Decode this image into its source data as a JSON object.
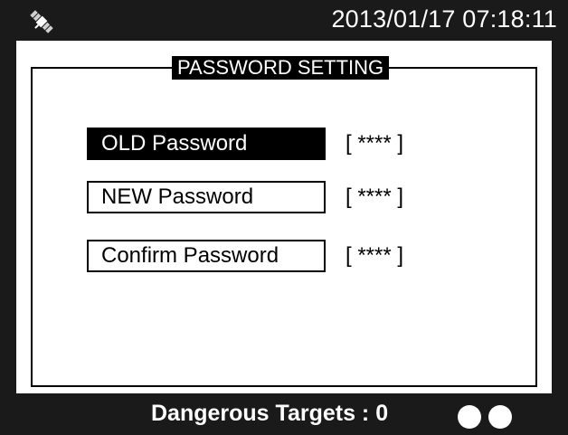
{
  "header": {
    "datetime": "2013/01/17 07:18:11",
    "status_icon": "satellite-icon"
  },
  "panel": {
    "title": "PASSWORD SETTING",
    "rows": [
      {
        "label": "OLD   Password",
        "value": "[ **** ]",
        "selected": true
      },
      {
        "label": "NEW  Password",
        "value": "[ **** ]",
        "selected": false
      },
      {
        "label": "Confirm Password",
        "value": "[ **** ]",
        "selected": false
      }
    ]
  },
  "footer": {
    "status_text": "Dangerous Targets : 0",
    "indicators": [
      "indicator-dot",
      "indicator-dot"
    ]
  },
  "colors": {
    "background": "#1a1a1a",
    "screen": "#ffffff",
    "selected": "#000000"
  }
}
